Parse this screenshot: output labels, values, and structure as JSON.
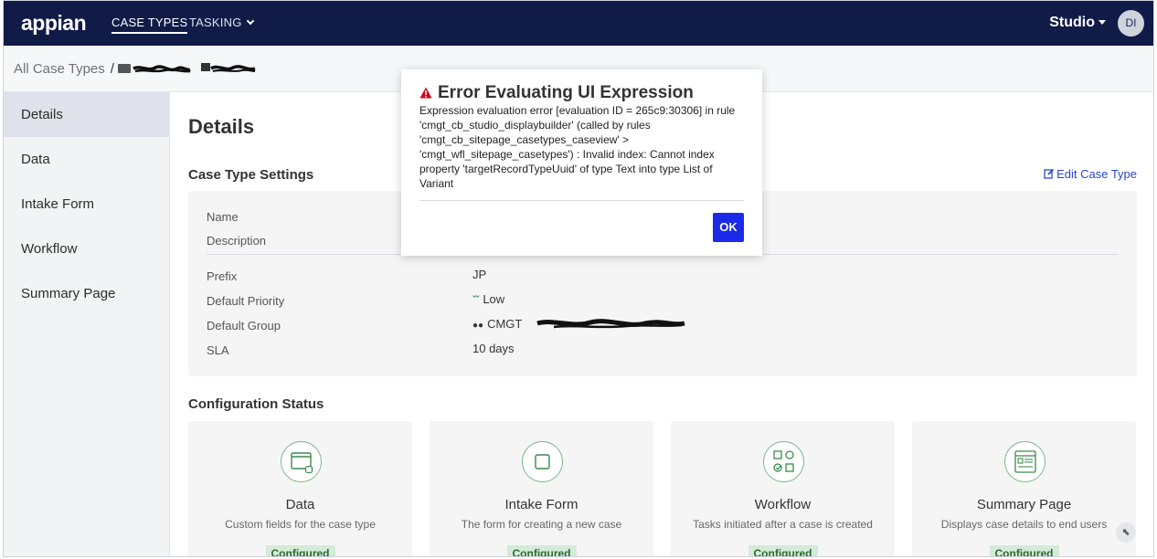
{
  "nav": {
    "logo": "appian",
    "tabs": [
      {
        "label": "CASE TYPES"
      },
      {
        "label": "TASKING"
      }
    ],
    "studio_label": "Studio",
    "avatar_initials": "DI"
  },
  "breadcrumb": {
    "root": "All Case Types",
    "separator": "/"
  },
  "sidebar": {
    "items": [
      {
        "label": "Details"
      },
      {
        "label": "Data"
      },
      {
        "label": "Intake Form"
      },
      {
        "label": "Workflow"
      },
      {
        "label": "Summary Page"
      }
    ]
  },
  "main": {
    "title": "Details",
    "settings_title": "Case Type Settings",
    "edit_label": "Edit Case Type",
    "rows": [
      {
        "label": "Name",
        "value": ""
      },
      {
        "label": "Description",
        "value": ""
      },
      {
        "label": "Prefix",
        "value": "JP"
      },
      {
        "label": "Default Priority",
        "value": "Low"
      },
      {
        "label": "Default Group",
        "value": "CMGT"
      },
      {
        "label": "SLA",
        "value": "10 days"
      }
    ],
    "config_title": "Configuration Status",
    "cards": [
      {
        "title": "Data",
        "desc": "Custom fields for the case type",
        "status": "Configured"
      },
      {
        "title": "Intake Form",
        "desc": "The form for creating a new case",
        "status": "Configured"
      },
      {
        "title": "Workflow",
        "desc": "Tasks initiated after a case is created",
        "status": "Configured"
      },
      {
        "title": "Summary Page",
        "desc": "Displays case details to end users",
        "status": "Configured"
      }
    ]
  },
  "dialog": {
    "title": "Error Evaluating UI Expression",
    "body": "Expression evaluation error [evaluation ID = 265c9:30306] in rule 'cmgt_cb_studio_displaybuilder' (called by rules 'cmgt_cb_sitepage_casetypes_caseview' > 'cmgt_wfl_sitepage_casetypes') : Invalid index: Cannot index property 'targetRecordTypeUuid' of type Text into type List of Variant",
    "ok_label": "OK"
  },
  "colors": {
    "nav_bg": "#111b48",
    "ok_button": "#1b29e8",
    "configured_badge": "#d4ebd7",
    "error_icon": "#d0021b"
  }
}
